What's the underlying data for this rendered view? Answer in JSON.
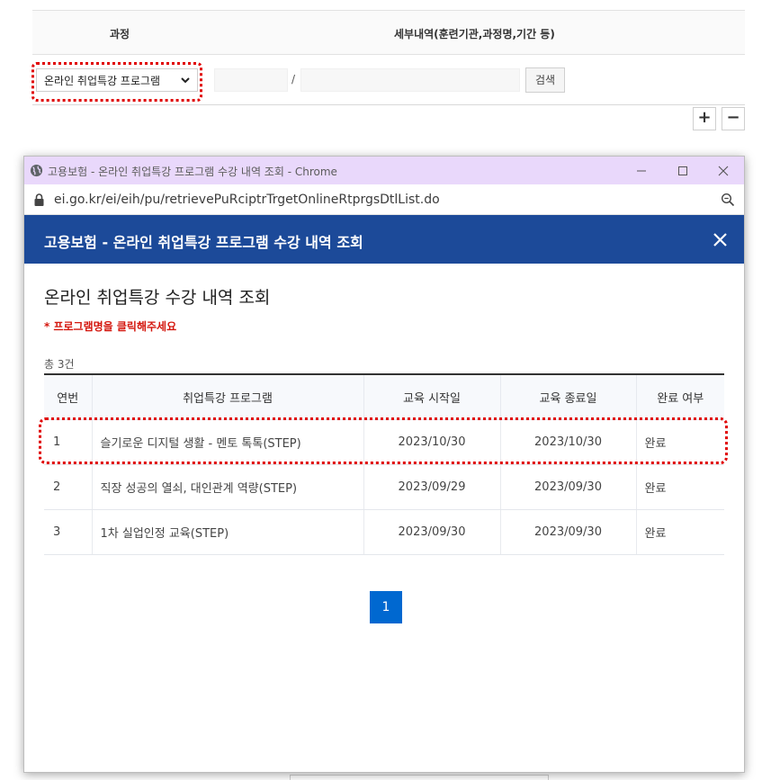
{
  "background": {
    "header_course": "과정",
    "header_detail": "세부내역(훈련기관,과정명,기간 등)",
    "select_value": "온라인 취업특강 프로그램",
    "slash": "/",
    "search_button": "검색",
    "plus_button": "+",
    "minus_button": "−"
  },
  "window": {
    "title": "고용보험 - 온라인 취업특강 프로그램 수강 내역 조회 - Chrome",
    "url": "ei.go.kr/ei/eih/pu/retrievePuRciptrTrgetOnlineRtprgsDtlList.do"
  },
  "popup": {
    "header_title": "고용보험 - 온라인 취업특강 프로그램 수강 내역 조회",
    "page_title": "온라인 취업특강 수강 내역 조회",
    "notice": "* 프로그램명을 클릭해주세요",
    "total": "총 3건",
    "columns": [
      "연번",
      "취업특강 프로그램",
      "교육 시작일",
      "교육 종료일",
      "완료 여부"
    ],
    "rows": [
      {
        "no": "1",
        "program": "슬기로운 디지털 생활 - 멘토 톡톡(STEP)",
        "start": "2023/10/30",
        "end": "2023/10/30",
        "status": "완료"
      },
      {
        "no": "2",
        "program": "직장 성공의 열쇠, 대인관계 역량(STEP)",
        "start": "2023/09/29",
        "end": "2023/09/30",
        "status": "완료"
      },
      {
        "no": "3",
        "program": "1차 실업인정 교육(STEP)",
        "start": "2023/09/30",
        "end": "2023/09/30",
        "status": "완료"
      }
    ],
    "current_page": "1"
  },
  "colors": {
    "header_bg": "#1c4a99",
    "titlebar_bg": "#e9d8fb",
    "link": "#1c38b8",
    "notice": "#d4170e",
    "pager": "#0068d0",
    "highlight": "#e00000"
  },
  "icons": [
    "globe-icon",
    "minimize-icon",
    "maximize-icon",
    "close-window-icon",
    "lock-icon",
    "zoom-icon",
    "close-icon",
    "chevron-down-icon"
  ]
}
